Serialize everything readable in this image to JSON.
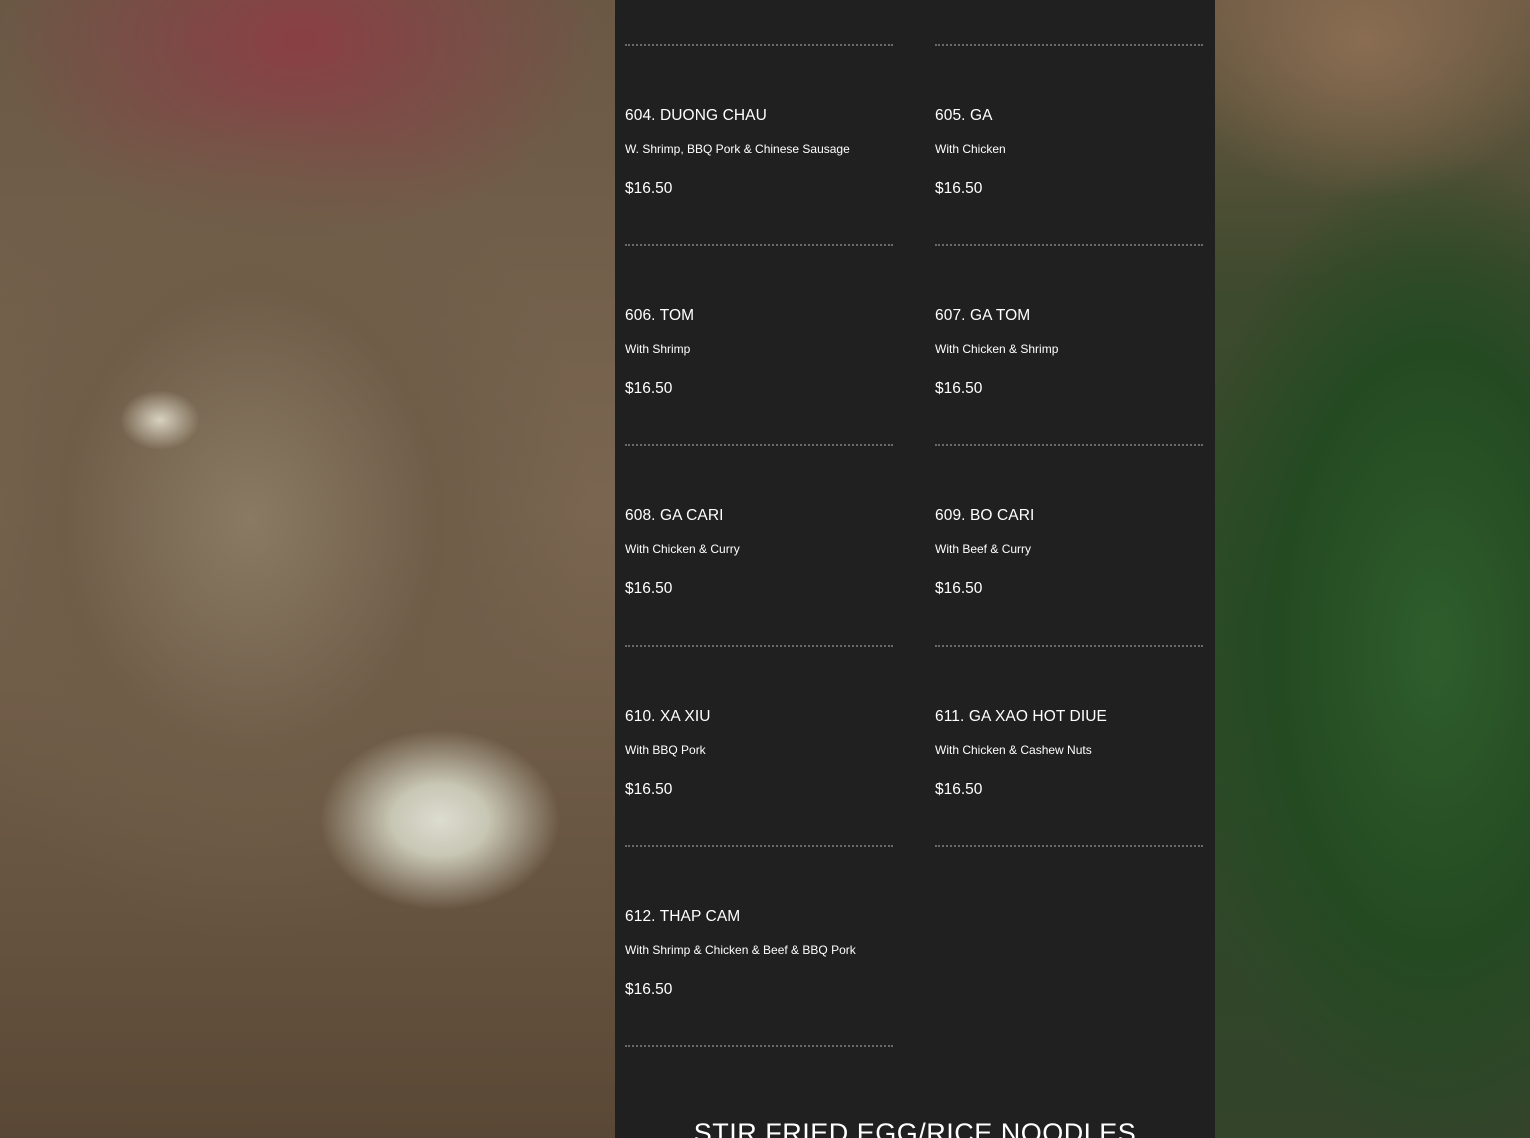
{
  "background": {
    "left_tone": "#6b5a45",
    "right_tone": "#2c4b27",
    "panel": "#202020",
    "text": "#ffffff",
    "divider": "#6a6a6a"
  },
  "menu": {
    "items": [
      {
        "name": "604. DUONG CHAU",
        "description": "W. Shrimp, BBQ Pork & Chinese Sausage",
        "price": "$16.50"
      },
      {
        "name": "605. GA",
        "description": "With Chicken",
        "price": "$16.50"
      },
      {
        "name": "606. TOM",
        "description": "With Shrimp",
        "price": "$16.50"
      },
      {
        "name": "607. GA TOM",
        "description": "With Chicken & Shrimp",
        "price": "$16.50"
      },
      {
        "name": "608. GA CARI",
        "description": "With Chicken & Curry",
        "price": "$16.50"
      },
      {
        "name": "609. BO CARI",
        "description": "With Beef & Curry",
        "price": "$16.50"
      },
      {
        "name": "610. XA XIU",
        "description": "With BBQ Pork",
        "price": "$16.50"
      },
      {
        "name": "611. GA XAO HOT DIUE",
        "description": "With Chicken & Cashew Nuts",
        "price": "$16.50"
      },
      {
        "name": "612. THAP CAM",
        "description": "With Shrimp & Chicken & Beef & BBQ Pork",
        "price": "$16.50"
      }
    ],
    "next_section_title": "STIR FRIED EGG/RICE NOODLES"
  }
}
